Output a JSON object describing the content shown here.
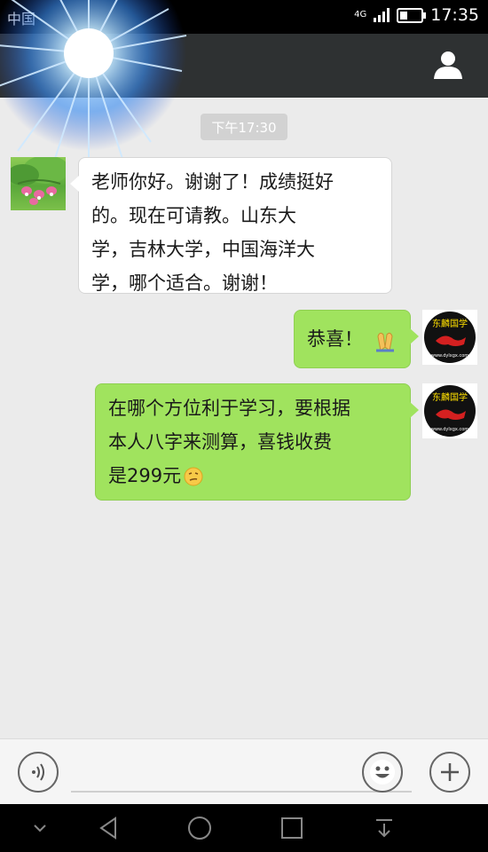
{
  "status_bar": {
    "carrier": "中国",
    "network": "4G",
    "time": "17:35"
  },
  "header": {
    "profile_icon": "person-icon"
  },
  "chat": {
    "timestamp": "下午17:30",
    "messages": [
      {
        "side": "left",
        "text": "老师你好。谢谢了！成绩挺好\n的。现在可请教。山东大\n学，吉林大学，中国海洋大\n学，哪个适合。谢谢！"
      },
      {
        "side": "right",
        "text": "恭喜！",
        "emoji": "folded-hands-icon"
      },
      {
        "side": "right",
        "text": "在哪个方位利于学习，要根据\n本人八字来测算，喜钱收费\n是299元",
        "emoji": "smirk-face-icon"
      }
    ],
    "right_avatar": {
      "line1": "东麟国学",
      "site": "www.dylxgx.com"
    }
  },
  "input_bar": {
    "voice_icon": "voice-icon",
    "emoji_icon": "smiley-icon",
    "add_icon": "plus-icon"
  },
  "colors": {
    "header_bg": "#2e3132",
    "chat_bg": "#ebebeb",
    "bubble_green": "#a0e35e",
    "bubble_white": "#ffffff"
  }
}
